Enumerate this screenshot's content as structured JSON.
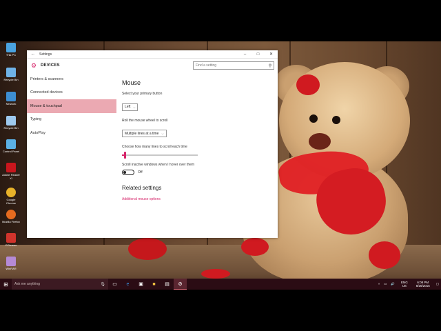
{
  "desktop": {
    "icons": [
      {
        "label": "This PC"
      },
      {
        "label": "Recycle Bin"
      },
      {
        "label": "Network"
      },
      {
        "label": "Recycle Bin"
      },
      {
        "label": "Control Panel"
      },
      {
        "label": "Adobe Reader XI"
      },
      {
        "label": "Google Chrome"
      },
      {
        "label": "Mozilla Firefox"
      },
      {
        "label": "CCleaner"
      },
      {
        "label": "WinRAR"
      }
    ]
  },
  "window": {
    "title": "Settings",
    "back_icon": "back-arrow-icon",
    "minimize": "–",
    "maximize": "□",
    "close": "✕",
    "header": "DEVICES",
    "header_icon": "gear-icon",
    "search_placeholder": "Find a setting"
  },
  "nav": {
    "items": [
      {
        "label": "Printers & scanners",
        "selected": false
      },
      {
        "label": "Connected devices",
        "selected": false
      },
      {
        "label": "Mouse & touchpad",
        "selected": true
      },
      {
        "label": "Typing",
        "selected": false
      },
      {
        "label": "AutoPlay",
        "selected": false
      }
    ]
  },
  "content": {
    "heading": "Mouse",
    "primary_button_label": "Select your primary button",
    "primary_button_value": "Left",
    "scroll_wheel_label": "Roll the mouse wheel to scroll",
    "scroll_wheel_value": "Multiple lines at a time",
    "lines_label": "Choose how many lines to scroll each time",
    "lines_level": 0.03,
    "inactive_label": "Scroll inactive windows when I hover over them",
    "inactive_state": "Off",
    "related_heading": "Related settings",
    "related_link": "Additional mouse options"
  },
  "taskbar": {
    "search_placeholder": "Ask me anything",
    "lang_top": "ENG",
    "lang_bottom": "US",
    "time": "6:08 PM",
    "date": "8/25/2015"
  },
  "colors": {
    "accent": "#d6256a",
    "nav_selected": "#eba9b2",
    "taskbar": "#2b0c14"
  }
}
